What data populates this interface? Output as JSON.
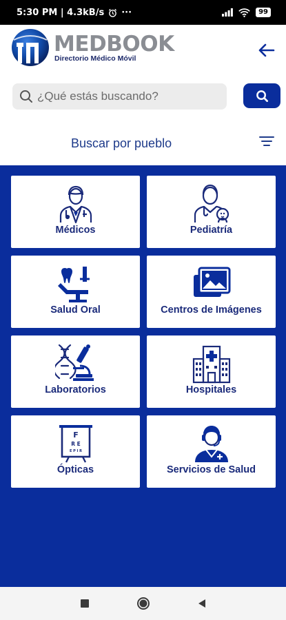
{
  "status_bar": {
    "time_speed": "5:30 PM | 4.3kB/s",
    "dots": "···",
    "battery": "99"
  },
  "header": {
    "brand_name": "MEDBOOK",
    "brand_tagline": "Directorio Médico Móvil"
  },
  "search": {
    "placeholder": "¿Qué estás buscando?"
  },
  "filter": {
    "label": "Buscar por pueblo"
  },
  "categories": [
    {
      "label": "Médicos",
      "icon": "doctor-icon"
    },
    {
      "label": "Pediatría",
      "icon": "pediatrician-icon"
    },
    {
      "label": "Salud Oral",
      "icon": "dental-chair-icon"
    },
    {
      "label": "Centros de Imágenes",
      "icon": "images-icon"
    },
    {
      "label": "Laboratorios",
      "icon": "microscope-dna-icon"
    },
    {
      "label": "Hospitales",
      "icon": "hospital-icon"
    },
    {
      "label": "Ópticas",
      "icon": "eye-chart-icon"
    },
    {
      "label": "Servicios de Salud",
      "icon": "nurse-headset-icon"
    }
  ],
  "eye_chart_letters": [
    "F",
    "R E",
    "E P I R"
  ],
  "colors": {
    "primary_blue": "#0a2d9c",
    "label_blue": "#1a2a7a",
    "brand_gray": "#8a8d93"
  }
}
